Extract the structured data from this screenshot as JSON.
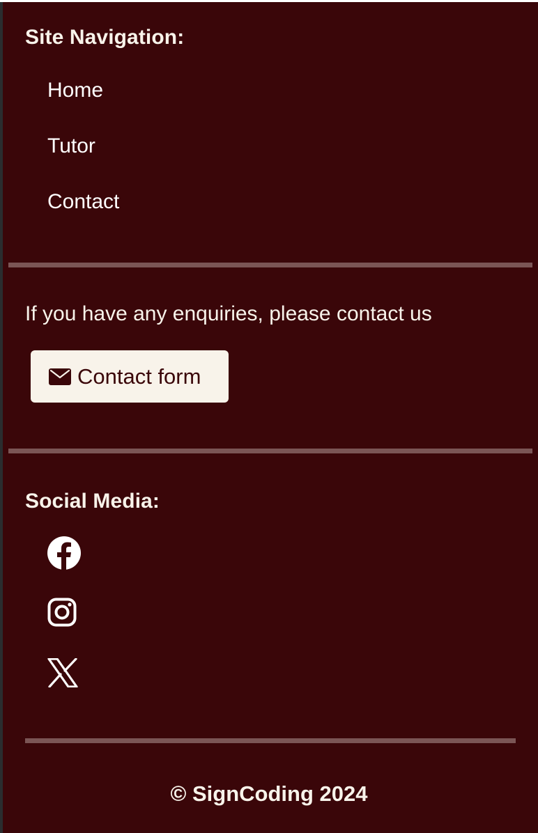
{
  "navigation": {
    "heading": "Site Navigation:",
    "items": [
      {
        "label": "Home"
      },
      {
        "label": "Tutor"
      },
      {
        "label": "Contact"
      }
    ]
  },
  "contact": {
    "text": "If you have any enquiries, please contact us",
    "button_label": "Contact form",
    "button_icon": "envelope-icon"
  },
  "social": {
    "heading": "Social Media:",
    "items": [
      {
        "name": "Facebook",
        "icon": "facebook-icon"
      },
      {
        "name": "Instagram",
        "icon": "instagram-icon"
      },
      {
        "name": "X",
        "icon": "x-icon"
      }
    ]
  },
  "footer": {
    "copyright": "© SignCoding 2024"
  },
  "colors": {
    "background": "#3a0609",
    "text": "#f8f3ea",
    "divider": "#7b5555",
    "button_background": "#f8f3ea",
    "button_text": "#3a0609"
  }
}
